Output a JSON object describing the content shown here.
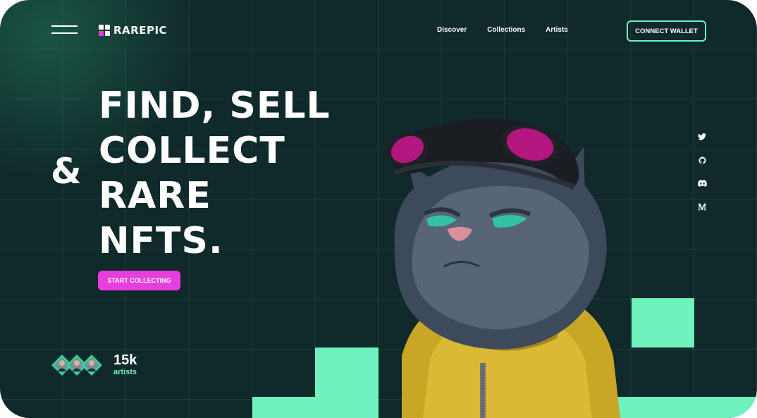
{
  "brand": {
    "name": "RAREPIC"
  },
  "nav": {
    "items": [
      "Discover",
      "Collections",
      "Artists"
    ]
  },
  "header": {
    "connect_label": "CONNECT WALLET"
  },
  "hero": {
    "lines": [
      "FIND, SELL",
      "COLLECT",
      "RARE",
      "NFTS."
    ],
    "ampersand": "&",
    "cta_label": "START COLLECTING"
  },
  "stats": {
    "count": "15k",
    "label": "artists"
  },
  "social": [
    "twitter-icon",
    "github-icon",
    "discord-icon",
    "medium-icon"
  ],
  "colors": {
    "background": "#10292a",
    "accent": "#6ff2bd",
    "cta": "#e83ede",
    "text": "#ffffff"
  }
}
